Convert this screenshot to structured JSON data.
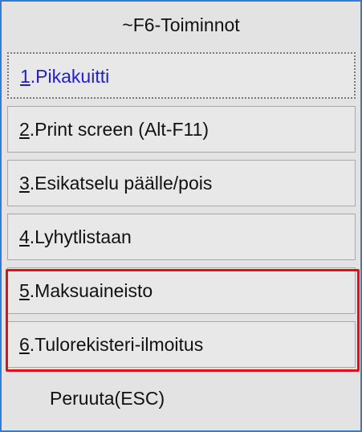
{
  "menu": {
    "title": "~F6-Toiminnot",
    "items": [
      {
        "key": "1",
        "label": ".Pikakuitti",
        "selected": true
      },
      {
        "key": "2",
        "label": ".Print screen (Alt-F11)"
      },
      {
        "key": "3",
        "label": ".Esikatselu päälle/pois"
      },
      {
        "key": "4",
        "label": ".Lyhytlistaan"
      },
      {
        "key": "5",
        "label": ".Maksuaineisto",
        "highlighted": true
      },
      {
        "key": "6",
        "label": ".Tulorekisteri-ilmoitus",
        "highlighted": true
      }
    ],
    "cancel_label": "Peruuta(ESC)"
  },
  "colors": {
    "frame_border": "#2c7fd6",
    "selected_text": "#1f1fd0",
    "highlight_border": "#e0101a"
  }
}
